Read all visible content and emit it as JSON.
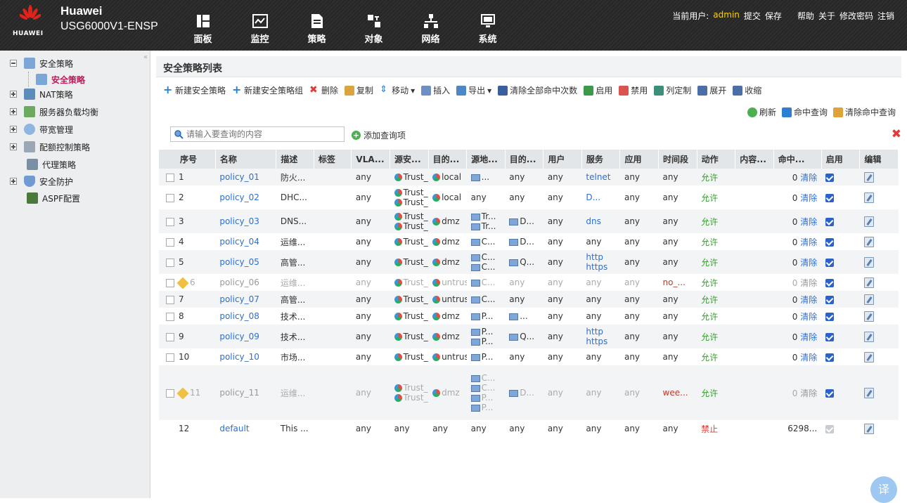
{
  "header": {
    "brand": "Huawei",
    "logo_word": "HUAWEI",
    "model": "USG6000V1-ENSP",
    "nav": [
      {
        "label": "面板",
        "icon": "dashboard-icon"
      },
      {
        "label": "监控",
        "icon": "monitor-icon"
      },
      {
        "label": "策略",
        "icon": "policy-icon"
      },
      {
        "label": "对象",
        "icon": "object-icon"
      },
      {
        "label": "网络",
        "icon": "network-icon"
      },
      {
        "label": "系统",
        "icon": "system-icon"
      }
    ],
    "current_user_label": "当前用户:",
    "current_user": "admin",
    "links": {
      "submit": "提交",
      "save": "保存",
      "help": "帮助",
      "about": "关于",
      "change_password": "修改密码",
      "logout": "注销"
    }
  },
  "sidebar": {
    "items": [
      {
        "label": "安全策略",
        "expanded": true
      },
      {
        "label": "NAT策略"
      },
      {
        "label": "服务器负载均衡"
      },
      {
        "label": "带宽管理"
      },
      {
        "label": "配额控制策略"
      },
      {
        "label": "代理策略"
      },
      {
        "label": "安全防护"
      },
      {
        "label": "ASPF配置"
      }
    ],
    "sub_selected": "安全策略"
  },
  "main": {
    "title": "安全策略列表",
    "toolbar": {
      "new_policy": "新建安全策略",
      "new_group": "新建安全策略组",
      "delete": "删除",
      "copy": "复制",
      "move": "移动",
      "insert": "插入",
      "export": "导出",
      "clear_hits": "清除全部命中次数",
      "enable": "启用",
      "disable": "禁用",
      "columns": "列定制",
      "expand": "展开",
      "collapse": "收缩"
    },
    "toolbar2": {
      "refresh": "刷新",
      "hit_query": "命中查询",
      "clear_hit_query": "清除命中查询"
    },
    "search": {
      "placeholder": "请输入要查询的内容"
    },
    "add_query": "添加查询项",
    "columns": [
      "序号",
      "名称",
      "描述",
      "标签",
      "VLA...",
      "源安...",
      "目的...",
      "源地...",
      "目的...",
      "用户",
      "服务",
      "应用",
      "时间段",
      "动作",
      "内容...",
      "命中...",
      "启用",
      "编辑"
    ],
    "clear_label": "清除"
  },
  "rows": [
    {
      "id": "1",
      "name": "policy_01",
      "desc": "防火...",
      "vlan": "any",
      "src_zone": [
        "Trust_"
      ],
      "dst_zone": "local",
      "src_addr": [
        "..."
      ],
      "dst_addr": "any",
      "user": "any",
      "service": [
        "telnet"
      ],
      "app": "any",
      "time": "any",
      "action": "允许",
      "hits": "0",
      "enabled": true,
      "disabled_row": false
    },
    {
      "id": "2",
      "name": "policy_02",
      "desc": "DHC...",
      "vlan": "any",
      "src_zone": [
        "Trust_",
        "Trust_"
      ],
      "dst_zone": "local",
      "src_addr": [
        "any"
      ],
      "dst_addr": "any",
      "user": "any",
      "service": [
        "D..."
      ],
      "app": "any",
      "time": "any",
      "action": "允许",
      "hits": "0",
      "enabled": true,
      "disabled_row": false
    },
    {
      "id": "3",
      "name": "policy_03",
      "desc": "DNS...",
      "vlan": "any",
      "src_zone": [
        "Trust_",
        "Trust_"
      ],
      "dst_zone": "dmz",
      "src_addr": [
        "Tr...",
        "Tr..."
      ],
      "dst_addr": "D...",
      "user": "any",
      "service": [
        "dns"
      ],
      "app": "any",
      "time": "any",
      "action": "允许",
      "hits": "0",
      "enabled": true,
      "disabled_row": false
    },
    {
      "id": "4",
      "name": "policy_04",
      "desc": "运维...",
      "vlan": "any",
      "src_zone": [
        "Trust_"
      ],
      "dst_zone": "dmz",
      "src_addr": [
        "C..."
      ],
      "dst_addr": "D...",
      "user": "any",
      "service": [
        "any"
      ],
      "app": "any",
      "time": "any",
      "action": "允许",
      "hits": "0",
      "enabled": true,
      "disabled_row": false
    },
    {
      "id": "5",
      "name": "policy_05",
      "desc": "高管...",
      "vlan": "any",
      "src_zone": [
        "Trust_"
      ],
      "dst_zone": "dmz",
      "src_addr": [
        "C...",
        "C..."
      ],
      "dst_addr": "Q...",
      "user": "any",
      "service": [
        "http",
        "https"
      ],
      "app": "any",
      "time": "any",
      "action": "允许",
      "hits": "0",
      "enabled": true,
      "disabled_row": false
    },
    {
      "id": "6",
      "name": "policy_06",
      "desc": "运维...",
      "vlan": "any",
      "src_zone": [
        "Trust_"
      ],
      "dst_zone": "untrus",
      "src_addr": [
        "C..."
      ],
      "dst_addr": "any",
      "user": "any",
      "service": [
        "any"
      ],
      "app": "any",
      "time": "no_...",
      "action": "允许",
      "hits": "0",
      "enabled": true,
      "disabled_row": true
    },
    {
      "id": "7",
      "name": "policy_07",
      "desc": "高管...",
      "vlan": "any",
      "src_zone": [
        "Trust_"
      ],
      "dst_zone": "untrus",
      "src_addr": [
        "C..."
      ],
      "dst_addr": "any",
      "user": "any",
      "service": [
        "any"
      ],
      "app": "any",
      "time": "any",
      "action": "允许",
      "hits": "0",
      "enabled": true,
      "disabled_row": false
    },
    {
      "id": "8",
      "name": "policy_08",
      "desc": "技术...",
      "vlan": "any",
      "src_zone": [
        "Trust_"
      ],
      "dst_zone": "dmz",
      "src_addr": [
        "P..."
      ],
      "dst_addr": "...",
      "user": "any",
      "service": [
        "any"
      ],
      "app": "any",
      "time": "any",
      "action": "允许",
      "hits": "0",
      "enabled": true,
      "disabled_row": false
    },
    {
      "id": "9",
      "name": "policy_09",
      "desc": "技术...",
      "vlan": "any",
      "src_zone": [
        "Trust_"
      ],
      "dst_zone": "dmz",
      "src_addr": [
        "P...",
        "P..."
      ],
      "dst_addr": "Q...",
      "user": "any",
      "service": [
        "http",
        "https"
      ],
      "app": "any",
      "time": "any",
      "action": "允许",
      "hits": "0",
      "enabled": true,
      "disabled_row": false
    },
    {
      "id": "10",
      "name": "policy_10",
      "desc": "市场...",
      "vlan": "any",
      "src_zone": [
        "Trust_"
      ],
      "dst_zone": "untrus",
      "src_addr": [
        "P..."
      ],
      "dst_addr": "any",
      "user": "any",
      "service": [
        "any"
      ],
      "app": "any",
      "time": "any",
      "action": "允许",
      "hits": "0",
      "enabled": true,
      "disabled_row": false
    },
    {
      "id": "11",
      "name": "policy_11",
      "desc": "运维...",
      "vlan": "any",
      "src_zone": [
        "Trust_",
        "Trust_"
      ],
      "dst_zone": "dmz",
      "src_addr": [
        "C...",
        "C...",
        "P...",
        "P..."
      ],
      "dst_addr": "D...",
      "user": "any",
      "service": [
        "any"
      ],
      "app": "any",
      "time": "wee...",
      "action": "允许",
      "hits": "0",
      "enabled": true,
      "disabled_row": true
    },
    {
      "id": "12",
      "name": "default",
      "desc": "This ...",
      "vlan": "any",
      "src_zone": [
        "any"
      ],
      "dst_zone": "any",
      "src_addr": [
        "any"
      ],
      "dst_addr": "any",
      "user": "any",
      "service": [
        "any"
      ],
      "app": "any",
      "time": "any",
      "action": "禁止",
      "hits": "6298...",
      "enabled": true,
      "disabled_row": false,
      "is_default": true
    }
  ],
  "translate_button": "译"
}
